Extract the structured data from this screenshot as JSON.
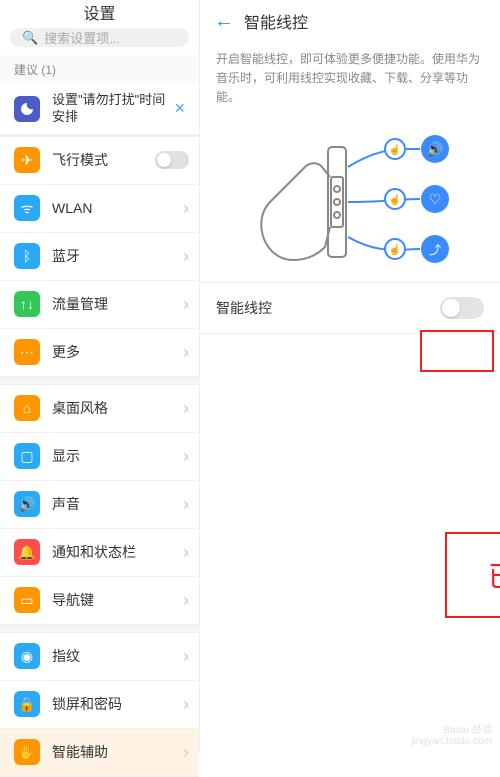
{
  "left": {
    "title": "设置",
    "search_placeholder": "搜索设置项...",
    "suggestion_label": "建议 (1)",
    "suggestion": {
      "icon": "moon-icon",
      "text": "设置\"请勿打扰\"时间安排",
      "color": "#4c5dc8"
    },
    "items": [
      {
        "icon": "airplane-icon",
        "label": "飞行模式",
        "color": "#ff9500",
        "trailing": "toggle"
      },
      {
        "icon": "wifi-icon",
        "label": "WLAN",
        "color": "#2aa9f5",
        "trailing": "chevron"
      },
      {
        "icon": "bluetooth-icon",
        "label": "蓝牙",
        "color": "#2aa9f5",
        "trailing": "chevron"
      },
      {
        "icon": "data-icon",
        "label": "流量管理",
        "color": "#34c759",
        "trailing": "chevron"
      },
      {
        "icon": "more-icon",
        "label": "更多",
        "color": "#ff9500",
        "trailing": "chevron",
        "gap_after": true
      },
      {
        "icon": "home-icon",
        "label": "桌面风格",
        "color": "#ff9500",
        "trailing": "chevron"
      },
      {
        "icon": "display-icon",
        "label": "显示",
        "color": "#2aa9f5",
        "trailing": "chevron"
      },
      {
        "icon": "sound-icon",
        "label": "声音",
        "color": "#2aa9f5",
        "trailing": "chevron"
      },
      {
        "icon": "bell-icon",
        "label": "通知和状态栏",
        "color": "#ff4d4d",
        "trailing": "chevron"
      },
      {
        "icon": "nav-icon",
        "label": "导航键",
        "color": "#ff9500",
        "trailing": "chevron",
        "gap_after": true
      },
      {
        "icon": "fingerprint-icon",
        "label": "指纹",
        "color": "#2aa9f5",
        "trailing": "chevron"
      },
      {
        "icon": "lock-icon",
        "label": "锁屏和密码",
        "color": "#2aa9f5",
        "trailing": "chevron"
      },
      {
        "icon": "hand-icon",
        "label": "智能辅助",
        "color": "#ff9500",
        "trailing": "chevron",
        "active": true
      }
    ]
  },
  "right": {
    "title": "智能线控",
    "description": "开启智能线控，即可体验更多便捷功能。使用华为音乐时，可利用线控实现收藏、下载、分享等功能。",
    "switch_label": "智能线控",
    "switch_state": "off"
  },
  "annotation": {
    "label": "已关闭"
  },
  "watermark": {
    "line1": "Baidu 经验",
    "line2": "jingyan.baidu.com"
  }
}
